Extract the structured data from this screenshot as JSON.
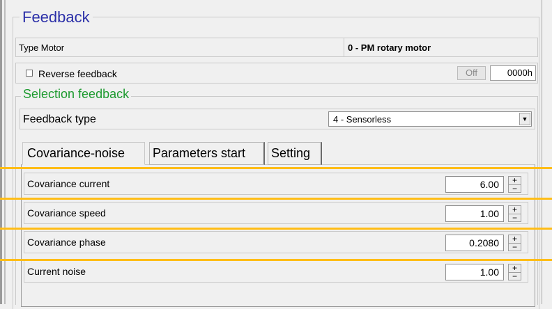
{
  "feedback": {
    "title": "Feedback",
    "type_motor_label": "Type Motor",
    "type_motor_value": "0 - PM rotary motor",
    "reverse_label": "Reverse feedback",
    "reverse_checked": false,
    "off_label": "Off",
    "hex_value": "0000h"
  },
  "selection": {
    "title": "Selection feedback",
    "feedback_type_label": "Feedback type",
    "feedback_type_value": "4 - Sensorless"
  },
  "tabs": [
    {
      "label": "Covariance-noise",
      "active": true
    },
    {
      "label": "Parameters start",
      "active": false
    },
    {
      "label": "Setting",
      "active": false
    }
  ],
  "params": [
    {
      "label": "Covariance current",
      "value": "6.00"
    },
    {
      "label": "Covariance speed",
      "value": "1.00"
    },
    {
      "label": "Covariance phase",
      "value": "0.2080"
    },
    {
      "label": "Current noise",
      "value": "1.00"
    }
  ],
  "spinner": {
    "up": "+",
    "down": "−"
  },
  "colors": {
    "feedback_title": "#2b2fa8",
    "selection_title": "#1d9a2f",
    "highlight": "#ffbd17"
  }
}
